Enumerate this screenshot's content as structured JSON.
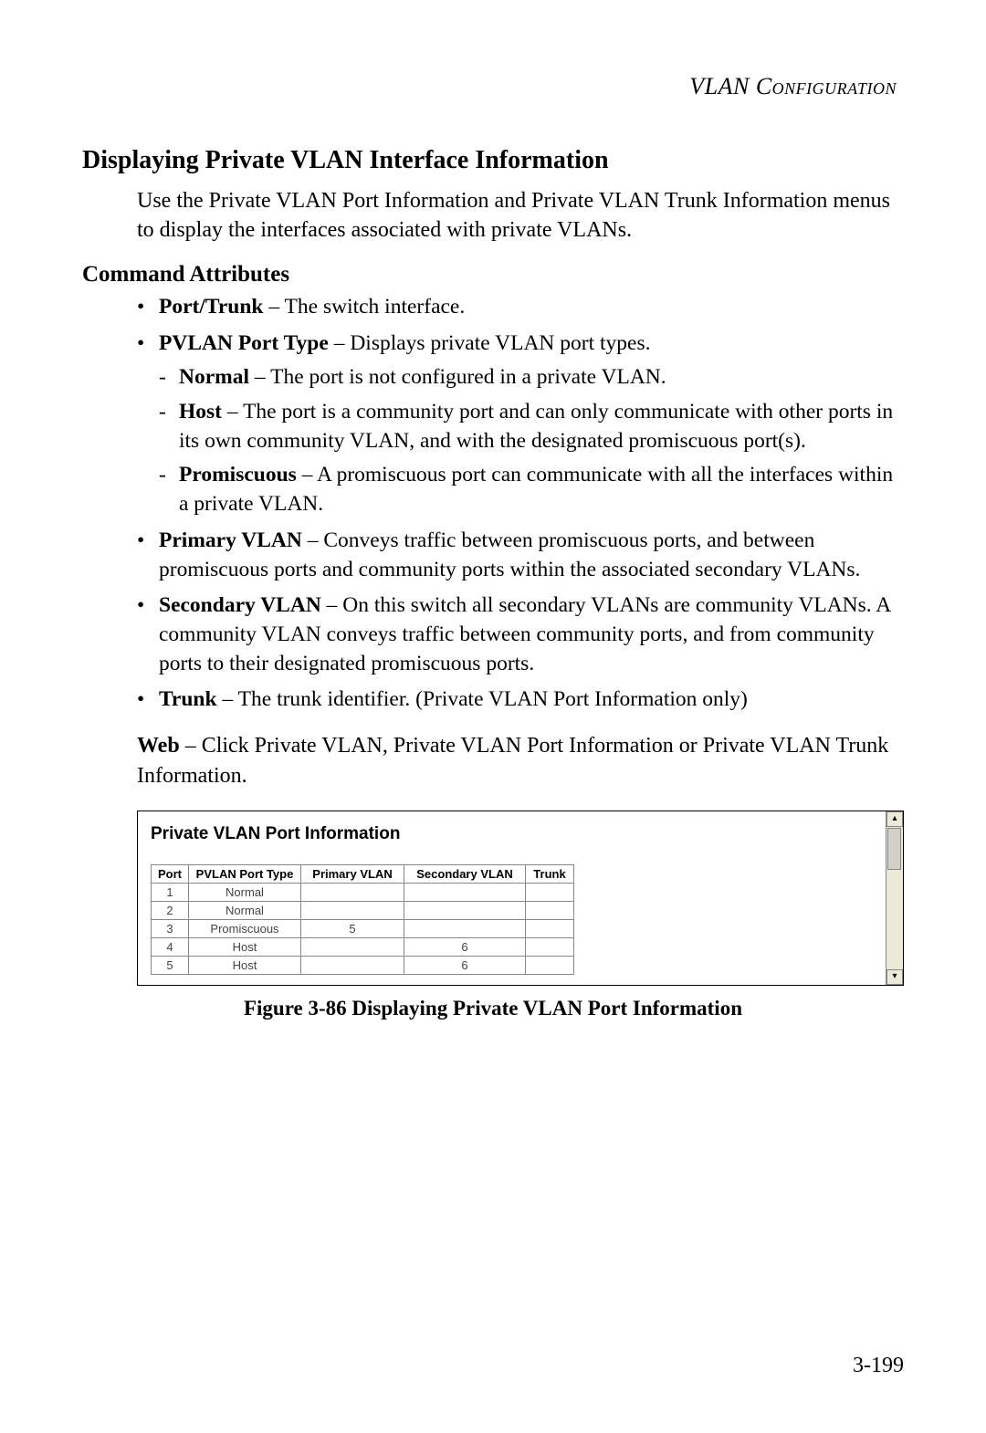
{
  "running_head": "VLAN Configuration",
  "section_heading": "Displaying Private VLAN Interface Information",
  "intro_paragraph": "Use the Private VLAN Port Information and Private VLAN Trunk Information menus to display the interfaces associated with private VLANs.",
  "command_attributes_heading": "Command Attributes",
  "attrs": {
    "port_trunk": {
      "term": "Port/Trunk",
      "desc": " – The switch interface."
    },
    "pvlan_port_type": {
      "term": "PVLAN Port Type",
      "desc": " – Displays private VLAN port types.",
      "sub": {
        "normal": {
          "term": "Normal",
          "desc": " – The port is not configured in a private VLAN."
        },
        "host": {
          "term": "Host",
          "desc": " – The port is a community port and can only communicate with other ports in its own community VLAN, and with the designated promiscuous port(s)."
        },
        "promiscuous": {
          "term": "Promiscuous",
          "desc": " – A promiscuous port can communicate with all the interfaces within a private VLAN."
        }
      }
    },
    "primary_vlan": {
      "term": "Primary VLAN",
      "desc": " – Conveys traffic between promiscuous ports, and between promiscuous ports and community ports within the associated secondary VLANs."
    },
    "secondary_vlan": {
      "term": "Secondary VLAN",
      "desc": " – On this switch all secondary VLANs are community VLANs. A community VLAN conveys traffic between community ports, and from community ports to their designated promiscuous ports."
    },
    "trunk": {
      "term": "Trunk",
      "desc": " – The trunk identifier. (Private VLAN Port Information only)"
    }
  },
  "web_lead": "Web",
  "web_desc": " – Click Private VLAN, Private VLAN Port Information or Private VLAN Trunk Information.",
  "panel_title": "Private VLAN Port Information",
  "table_headers": {
    "port": "Port",
    "type": "PVLAN Port Type",
    "primary": "Primary VLAN",
    "secondary": "Secondary VLAN",
    "trunk": "Trunk"
  },
  "rows": [
    {
      "port": "1",
      "type": "Normal",
      "primary": "",
      "secondary": "",
      "trunk": ""
    },
    {
      "port": "2",
      "type": "Normal",
      "primary": "",
      "secondary": "",
      "trunk": ""
    },
    {
      "port": "3",
      "type": "Promiscuous",
      "primary": "5",
      "secondary": "",
      "trunk": ""
    },
    {
      "port": "4",
      "type": "Host",
      "primary": "",
      "secondary": "6",
      "trunk": ""
    },
    {
      "port": "5",
      "type": "Host",
      "primary": "",
      "secondary": "6",
      "trunk": ""
    }
  ],
  "figure_caption": "Figure 3-86  Displaying Private VLAN Port Information",
  "page_number": "3-199",
  "scroll": {
    "up": "▴",
    "down": "▾"
  }
}
